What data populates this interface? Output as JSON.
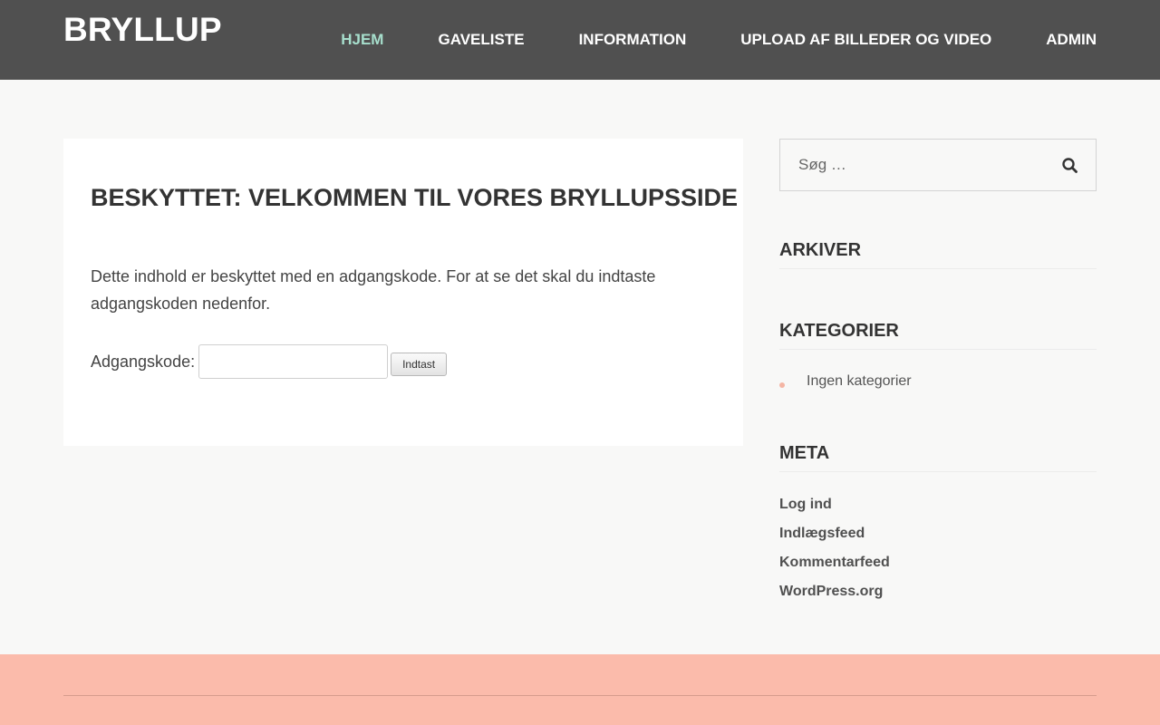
{
  "site": {
    "title": "BRYLLUP"
  },
  "nav": {
    "items": [
      {
        "label": "HJEM",
        "current": true
      },
      {
        "label": "GAVELISTE",
        "current": false
      },
      {
        "label": "INFORMATION",
        "current": false
      },
      {
        "label": "UPLOAD AF BILLEDER OG VIDEO",
        "current": false
      },
      {
        "label": "ADMIN",
        "current": false
      }
    ],
    "current_color": "#a7dfcd"
  },
  "post": {
    "title": "BESKYTTET: VELKOMMEN TIL VORES BRYLLUPSSIDE",
    "text": "Dette indhold er beskyttet med en adgangskode. For at se det skal du indtaste adgangskoden nedenfor.",
    "password_label": "Adgangskode:",
    "password_value": "",
    "submit_label": "Indtast"
  },
  "sidebar": {
    "search": {
      "placeholder": "Søg …",
      "icon": "search-icon"
    },
    "archives": {
      "title": "ARKIVER"
    },
    "categories": {
      "title": "KATEGORIER",
      "items": [
        "Ingen kategorier"
      ]
    },
    "meta": {
      "title": "META",
      "links": [
        "Log ind",
        "Indlægsfeed",
        "Kommentarfeed",
        "WordPress.org"
      ]
    }
  },
  "colors": {
    "header_bg": "#505050",
    "footer_bg": "#fbbbab",
    "page_bg": "#f8f8f7",
    "bullet": "#f4b5a4"
  }
}
